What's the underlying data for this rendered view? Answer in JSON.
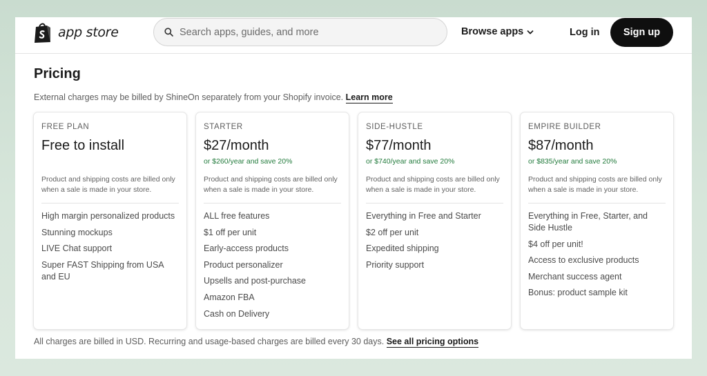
{
  "header": {
    "logo_text": "app store",
    "search_placeholder": "Search apps, guides, and more",
    "browse_label": "Browse apps",
    "login_label": "Log in",
    "signup_label": "Sign up"
  },
  "pricing": {
    "title": "Pricing",
    "notice_text": "External charges may be billed by ShineOn separately from your Shopify invoice.",
    "notice_link": "Learn more",
    "footer_text": "All charges are billed in USD. Recurring and usage-based charges are billed every 30 days.",
    "footer_link": "See all pricing options",
    "plans": [
      {
        "name": "FREE PLAN",
        "price": "Free to install",
        "yearly": "",
        "description": "Product and shipping costs are billed only when a sale is made in your store.",
        "features": [
          "High margin personalized products",
          "Stunning mockups",
          "LIVE Chat support",
          "Super FAST Shipping from USA and EU"
        ]
      },
      {
        "name": "STARTER",
        "price": "$27/month",
        "yearly": "or $260/year and save 20%",
        "description": "Product and shipping costs are billed only when a sale is made in your store.",
        "features": [
          "ALL free features",
          "$1 off per unit",
          "Early-access products",
          "Product personalizer",
          "Upsells and post-purchase",
          "Amazon FBA",
          "Cash on Delivery"
        ]
      },
      {
        "name": "SIDE-HUSTLE",
        "price": "$77/month",
        "yearly": "or $740/year and save 20%",
        "description": "Product and shipping costs are billed only when a sale is made in your store.",
        "features": [
          "Everything in Free and Starter",
          "$2 off per unit",
          "Expedited shipping",
          "Priority support"
        ]
      },
      {
        "name": "EMPIRE BUILDER",
        "price": "$87/month",
        "yearly": "or $835/year and save 20%",
        "description": "Product and shipping costs are billed only when a sale is made in your store.",
        "features": [
          "Everything in Free, Starter, and Side Hustle",
          "$4 off per unit!",
          "Access to exclusive products",
          "Merchant success agent",
          "Bonus: product sample kit"
        ]
      }
    ]
  },
  "colors": {
    "accent_green": "#217a3b",
    "signup_bg": "#0f0f0f",
    "logo_green": "#1a1a1a"
  },
  "icons": {
    "logo": "shopify-bag-icon",
    "search": "search-icon",
    "browse": "chevron-down-icon"
  }
}
